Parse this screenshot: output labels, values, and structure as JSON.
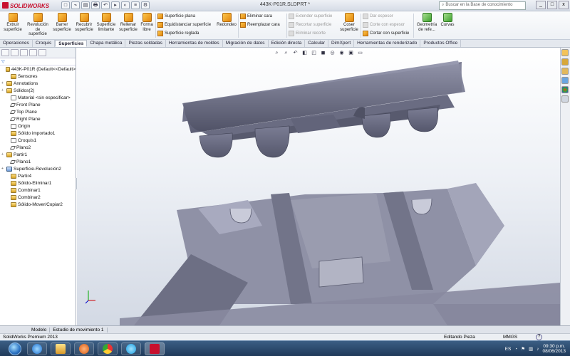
{
  "app": {
    "logo": "SOLIDWORKS",
    "doc_title": "443K-P01R.SLDPRT *",
    "kb_search_placeholder": "Buscar en la Base de conocimiento",
    "window_controls": [
      "_",
      "□",
      "x"
    ]
  },
  "qat": [
    "□",
    "⌁",
    "▤",
    "🖶",
    "↶",
    "▸",
    "◐",
    "≡",
    "⚙"
  ],
  "ribbon": {
    "big": [
      {
        "label": "Extruir superficie",
        "icon": "extrude-surface-icon"
      },
      {
        "label": "Revolución de superficie",
        "icon": "revolve-surface-icon"
      },
      {
        "label": "Barrer superficie",
        "icon": "sweep-surface-icon"
      },
      {
        "label": "Recubrir superficie",
        "icon": "loft-surface-icon"
      },
      {
        "label": "Superficie limitante",
        "icon": "boundary-surface-icon"
      },
      {
        "label": "Rellenar superficie",
        "icon": "fill-surface-icon"
      },
      {
        "label": "Forma libre",
        "icon": "freeform-icon"
      }
    ],
    "col1": [
      "Superficie plana",
      "Equidistanciar superficie",
      "Superficie reglada"
    ],
    "redondeo": "Redondeo",
    "col2": [
      "Eliminar cara",
      "Reemplazar cara"
    ],
    "col3": [
      "Extender superficie",
      "Recortar superficie",
      "Eliminar recorte"
    ],
    "coser": "Coser superficie",
    "col4": [
      "Dar espesor",
      "Corte con espesor",
      "Cortar con superficie"
    ],
    "geom": "Geometría de refe...",
    "curvas": "Curvas"
  },
  "tabs": [
    "Operaciones",
    "Croquis",
    "Superficies",
    "Chapa metálica",
    "Piezas soldadas",
    "Herramientas de moldes",
    "Migración de datos",
    "Edición directa",
    "Calcular",
    "DimXpert",
    "Herramientas de renderizado",
    "Productos Office"
  ],
  "active_tab": "Superficies",
  "tree": [
    {
      "label": "443K-P01R  (Default<<Default>",
      "icon": "part",
      "exp": ""
    },
    {
      "label": "Sensores",
      "icon": "folder",
      "exp": ""
    },
    {
      "label": "Annotations",
      "icon": "annot",
      "exp": "+"
    },
    {
      "label": "Sólidos(2)",
      "icon": "folder",
      "exp": "+"
    },
    {
      "label": "Material <sin especificar>",
      "icon": "material",
      "exp": ""
    },
    {
      "label": "Front Plane",
      "icon": "plane",
      "exp": ""
    },
    {
      "label": "Top Plane",
      "icon": "plane",
      "exp": ""
    },
    {
      "label": "Right Plane",
      "icon": "plane",
      "exp": ""
    },
    {
      "label": "Origin",
      "icon": "origin",
      "exp": ""
    },
    {
      "label": "Sólido importado1",
      "icon": "feature",
      "exp": ""
    },
    {
      "label": "Croquis1",
      "icon": "sketch",
      "exp": ""
    },
    {
      "label": "Plano2",
      "icon": "plane",
      "exp": ""
    },
    {
      "label": "Partir1",
      "icon": "feature",
      "exp": "+"
    },
    {
      "label": "Plano1",
      "icon": "plane",
      "exp": ""
    },
    {
      "label": "Superficie-Revolución2",
      "icon": "surface",
      "exp": "+"
    },
    {
      "label": "Partir4",
      "icon": "feature",
      "exp": ""
    },
    {
      "label": "Sólido-Eliminar1",
      "icon": "feature",
      "exp": ""
    },
    {
      "label": "Combinar1",
      "icon": "feature",
      "exp": ""
    },
    {
      "label": "Combinar2",
      "icon": "feature",
      "exp": ""
    },
    {
      "label": "Sólido-Mover/Copiar2",
      "icon": "feature",
      "exp": ""
    }
  ],
  "bottom_tabs": [
    "Modelo",
    "Estudio de movimiento 1"
  ],
  "status": {
    "left": "SolidWorks Premium 2013",
    "mode": "Editando Pieza",
    "units": "MMGS",
    "help": "?"
  },
  "taskbar": {
    "lang": "ES",
    "time": "09:30 p.m.",
    "date": "08/06/2013",
    "apps": [
      "ie-icon",
      "explorer-icon",
      "media-icon",
      "chrome-icon",
      "skype-icon",
      "word-icon",
      "solidworks-icon"
    ]
  }
}
